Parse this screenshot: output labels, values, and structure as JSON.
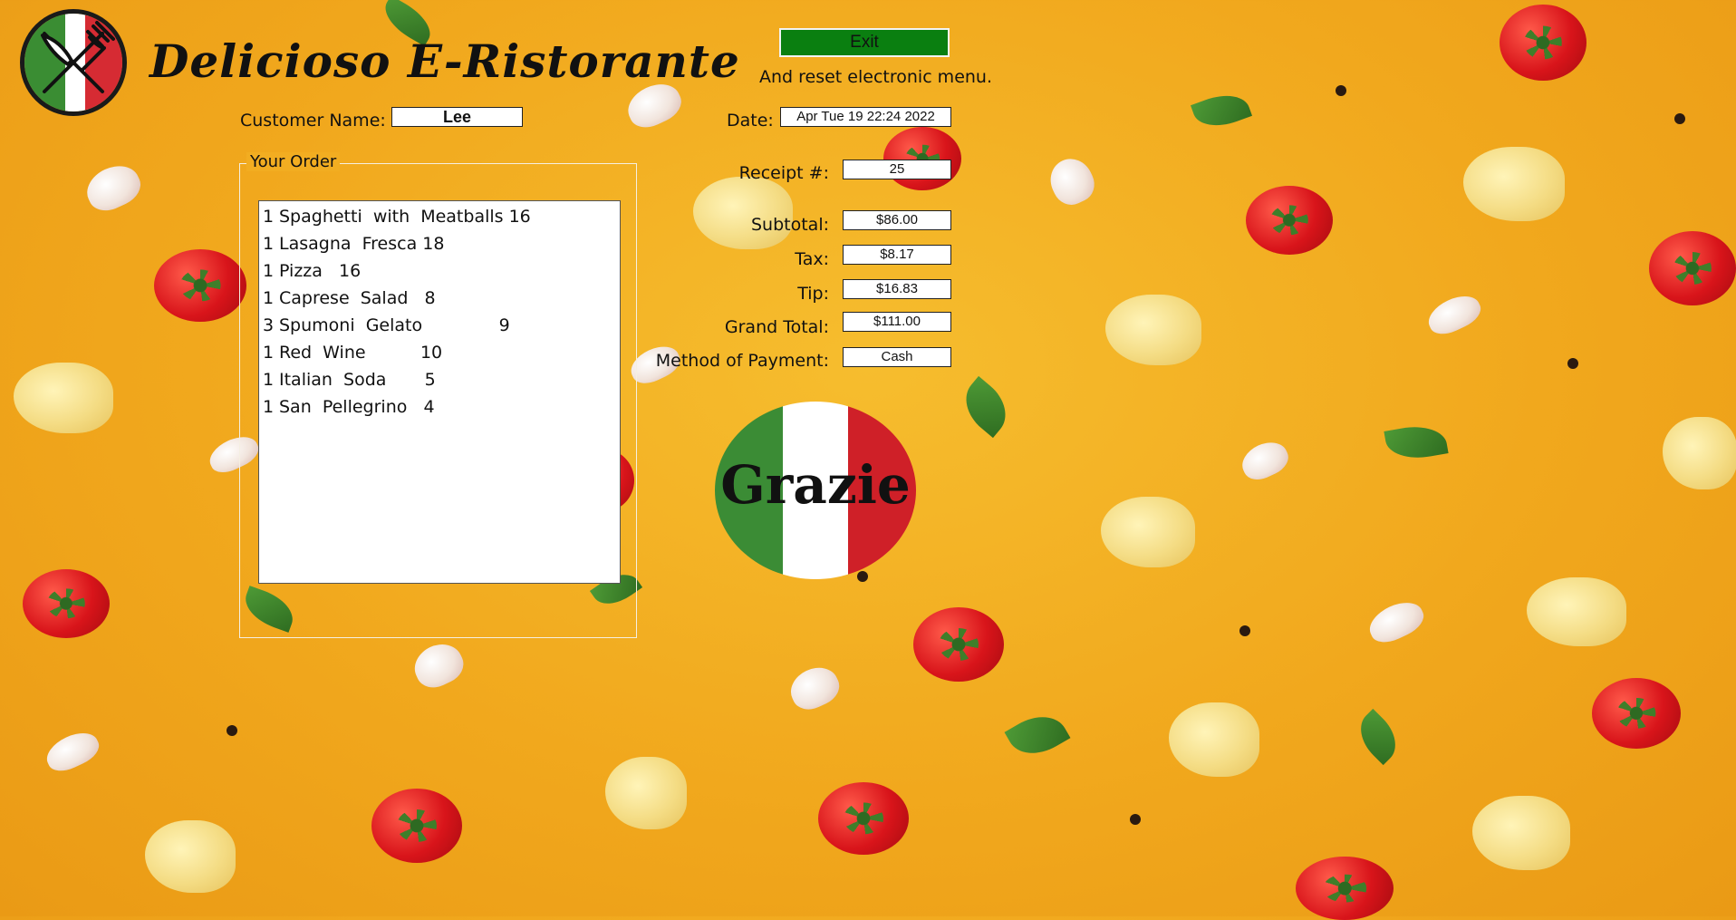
{
  "app": {
    "title": "Delicioso  E-Ristorante"
  },
  "exit": {
    "label": "Exit",
    "note": "And reset electronic menu."
  },
  "customer": {
    "label": "Customer Name:",
    "value": "Lee"
  },
  "date": {
    "label": "Date:",
    "value": "Apr Tue 19 22:24 2022"
  },
  "order": {
    "title": "Your Order",
    "items": [
      {
        "qty": "1",
        "text": "Spaghetti  with  Meatballs 16"
      },
      {
        "qty": "1",
        "text": "Lasagna  Fresca 18"
      },
      {
        "qty": "1",
        "text": "Pizza   16"
      },
      {
        "qty": "1",
        "text": "Caprese  Salad   8"
      },
      {
        "qty": "3",
        "text": "Spumoni  Gelato              9"
      },
      {
        "qty": "1",
        "text": "Red  Wine          10"
      },
      {
        "qty": "1",
        "text": "Italian  Soda       5"
      },
      {
        "qty": "1",
        "text": "San  Pellegrino   4"
      }
    ]
  },
  "summary": {
    "receipt": {
      "label": "Receipt #:",
      "value": "25"
    },
    "subtotal": {
      "label": "Subtotal:",
      "value": "$86.00"
    },
    "tax": {
      "label": "Tax:",
      "value": "$8.17"
    },
    "tip": {
      "label": "Tip:",
      "value": "$16.83"
    },
    "grand_total": {
      "label": "Grand Total:",
      "value": "$111.00"
    },
    "payment": {
      "label": "Method of Payment:",
      "value": "Cash"
    }
  },
  "thanks": {
    "text": "Grazie"
  },
  "colors": {
    "exit_button": "#0a7f10",
    "italy_green": "#3b8c35",
    "italy_red": "#cf2028",
    "background": "#f1a81d"
  },
  "icons": {
    "logo": "fork-knife-icon"
  }
}
